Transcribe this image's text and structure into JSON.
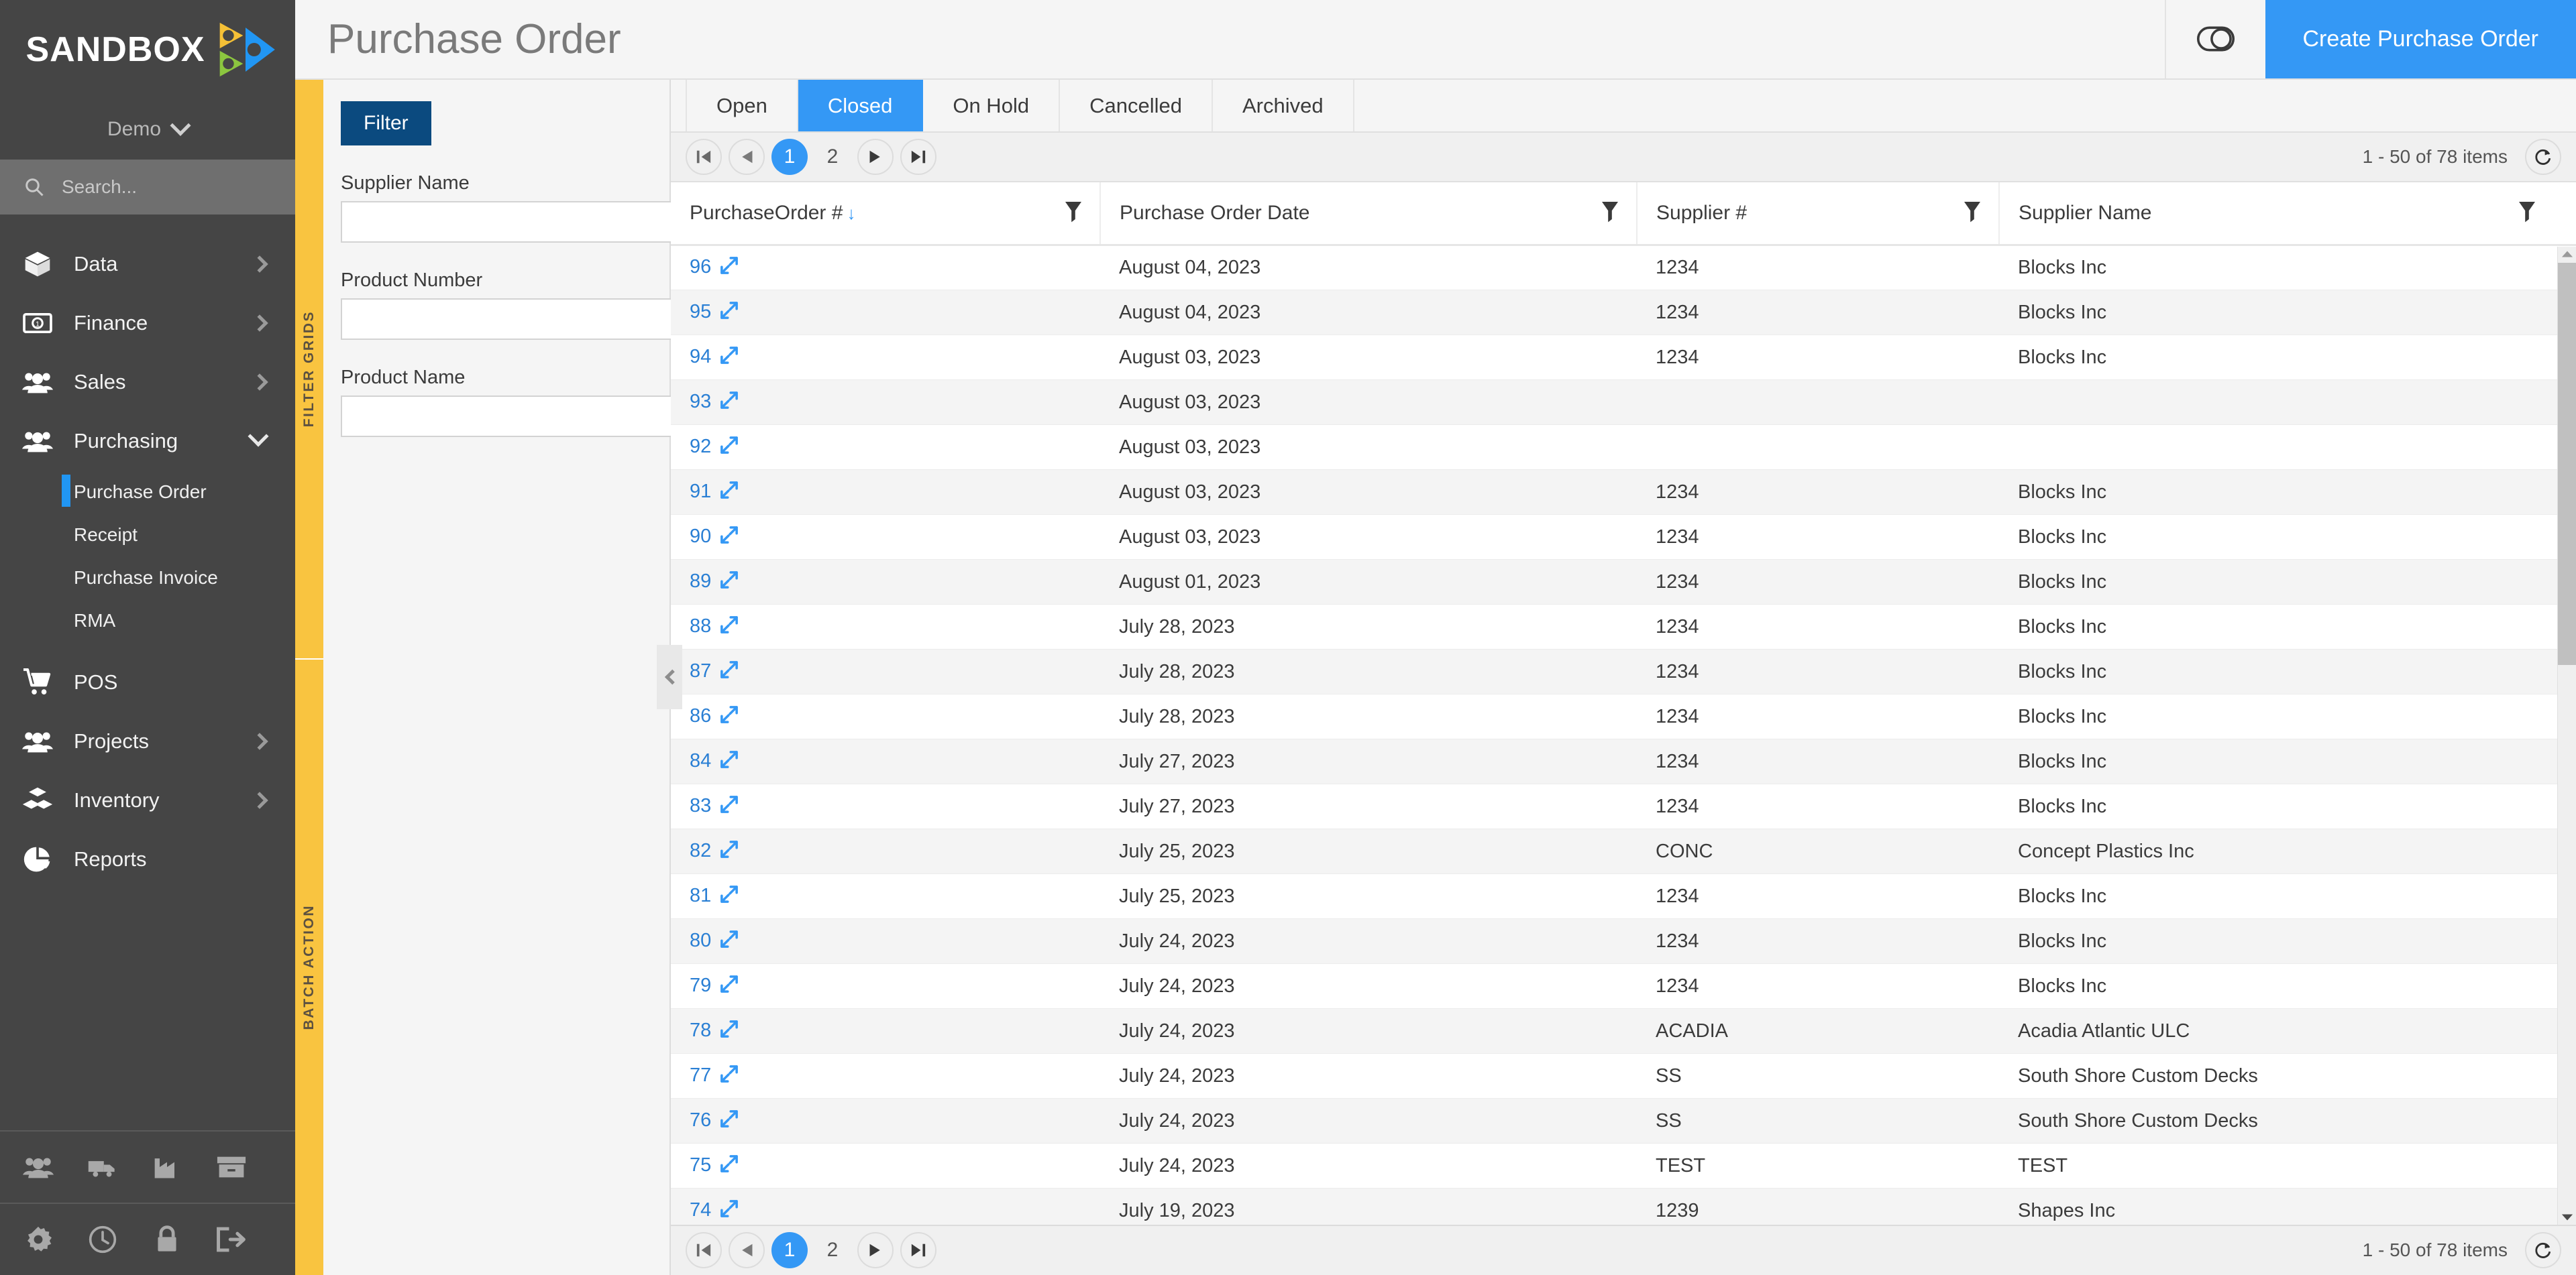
{
  "brand": {
    "name": "SANDBOX",
    "tenant": "Demo"
  },
  "search": {
    "placeholder": "Search..."
  },
  "sidebar": {
    "items": [
      {
        "label": "Data",
        "icon": "box-icon",
        "expandable": true
      },
      {
        "label": "Finance",
        "icon": "banknote-icon",
        "expandable": true
      },
      {
        "label": "Sales",
        "icon": "people-icon",
        "expandable": true
      },
      {
        "label": "Purchasing",
        "icon": "people-icon",
        "expandable": true,
        "expanded": true
      },
      {
        "label": "POS",
        "icon": "cart-icon",
        "expandable": false
      },
      {
        "label": "Projects",
        "icon": "people-icon",
        "expandable": true
      },
      {
        "label": "Inventory",
        "icon": "boxes-icon",
        "expandable": true
      },
      {
        "label": "Reports",
        "icon": "pie-chart-icon",
        "expandable": false
      }
    ],
    "purchasing_sub": [
      {
        "label": "Purchase Order",
        "active": true
      },
      {
        "label": "Receipt",
        "active": false
      },
      {
        "label": "Purchase Invoice",
        "active": false
      },
      {
        "label": "RMA",
        "active": false
      }
    ],
    "footer_row1": [
      "people-icon",
      "truck-icon",
      "factory-icon",
      "archive-icon"
    ],
    "footer_row2": [
      "gear-icon",
      "clock-icon",
      "lock-icon",
      "logout-icon"
    ]
  },
  "header": {
    "title": "Purchase Order",
    "toggle_icon": "toggle-switch-icon",
    "create_label": "Create Purchase Order"
  },
  "rail": {
    "top_label": "FILTER GRIDS",
    "bottom_label": "BATCH ACTION"
  },
  "filter": {
    "button_label": "Filter",
    "fields": [
      {
        "label": "Supplier Name",
        "value": "",
        "placeholder": ""
      },
      {
        "label": "Product Number",
        "value": "",
        "placeholder": ""
      },
      {
        "label": "Product Name",
        "value": "",
        "placeholder": ""
      }
    ]
  },
  "tabs": [
    {
      "label": "Open",
      "active": false
    },
    {
      "label": "Closed",
      "active": true
    },
    {
      "label": "On Hold",
      "active": false
    },
    {
      "label": "Cancelled",
      "active": false
    },
    {
      "label": "Archived",
      "active": false
    }
  ],
  "pager": {
    "first": "⏮",
    "prev": "◀",
    "next": "▶",
    "last": "⏭",
    "pages": [
      "1",
      "2"
    ],
    "current_page": "1",
    "info": "1 - 50 of 78 items",
    "refresh_icon": "refresh-icon"
  },
  "table": {
    "columns": [
      {
        "label": "PurchaseOrder #",
        "sorted": true,
        "sort_dir": "desc",
        "filter_icon": "funnel-icon"
      },
      {
        "label": "Purchase Order Date",
        "sorted": false,
        "filter_icon": "funnel-icon"
      },
      {
        "label": "Supplier #",
        "sorted": false,
        "filter_icon": "funnel-icon"
      },
      {
        "label": "Supplier Name",
        "sorted": false,
        "filter_icon": "funnel-icon"
      }
    ],
    "rows": [
      {
        "po": "96",
        "date": "August 04, 2023",
        "supplier_no": "1234",
        "supplier_name": "Blocks Inc"
      },
      {
        "po": "95",
        "date": "August 04, 2023",
        "supplier_no": "1234",
        "supplier_name": "Blocks Inc"
      },
      {
        "po": "94",
        "date": "August 03, 2023",
        "supplier_no": "1234",
        "supplier_name": "Blocks Inc"
      },
      {
        "po": "93",
        "date": "August 03, 2023",
        "supplier_no": "",
        "supplier_name": ""
      },
      {
        "po": "92",
        "date": "August 03, 2023",
        "supplier_no": "",
        "supplier_name": ""
      },
      {
        "po": "91",
        "date": "August 03, 2023",
        "supplier_no": "1234",
        "supplier_name": "Blocks Inc"
      },
      {
        "po": "90",
        "date": "August 03, 2023",
        "supplier_no": "1234",
        "supplier_name": "Blocks Inc"
      },
      {
        "po": "89",
        "date": "August 01, 2023",
        "supplier_no": "1234",
        "supplier_name": "Blocks Inc"
      },
      {
        "po": "88",
        "date": "July 28, 2023",
        "supplier_no": "1234",
        "supplier_name": "Blocks Inc"
      },
      {
        "po": "87",
        "date": "July 28, 2023",
        "supplier_no": "1234",
        "supplier_name": "Blocks Inc"
      },
      {
        "po": "86",
        "date": "July 28, 2023",
        "supplier_no": "1234",
        "supplier_name": "Blocks Inc"
      },
      {
        "po": "84",
        "date": "July 27, 2023",
        "supplier_no": "1234",
        "supplier_name": "Blocks Inc"
      },
      {
        "po": "83",
        "date": "July 27, 2023",
        "supplier_no": "1234",
        "supplier_name": "Blocks Inc"
      },
      {
        "po": "82",
        "date": "July 25, 2023",
        "supplier_no": "CONC",
        "supplier_name": "Concept Plastics Inc"
      },
      {
        "po": "81",
        "date": "July 25, 2023",
        "supplier_no": "1234",
        "supplier_name": "Blocks Inc"
      },
      {
        "po": "80",
        "date": "July 24, 2023",
        "supplier_no": "1234",
        "supplier_name": "Blocks Inc"
      },
      {
        "po": "79",
        "date": "July 24, 2023",
        "supplier_no": "1234",
        "supplier_name": "Blocks Inc"
      },
      {
        "po": "78",
        "date": "July 24, 2023",
        "supplier_no": "ACADIA",
        "supplier_name": "Acadia Atlantic ULC"
      },
      {
        "po": "77",
        "date": "July 24, 2023",
        "supplier_no": "SS",
        "supplier_name": "South Shore Custom Decks"
      },
      {
        "po": "76",
        "date": "July 24, 2023",
        "supplier_no": "SS",
        "supplier_name": "South Shore Custom Decks"
      },
      {
        "po": "75",
        "date": "July 24, 2023",
        "supplier_no": "TEST",
        "supplier_name": "TEST"
      },
      {
        "po": "74",
        "date": "July 19, 2023",
        "supplier_no": "1239",
        "supplier_name": "Shapes Inc"
      }
    ],
    "row_expand_icon": "expand-diagonal-icon"
  },
  "colors": {
    "accent_blue": "#3498f5",
    "rail_yellow": "#f9c440",
    "sidebar_dark": "#454545",
    "filter_button": "#0b4a7f",
    "link_blue": "#2a7fd4"
  }
}
